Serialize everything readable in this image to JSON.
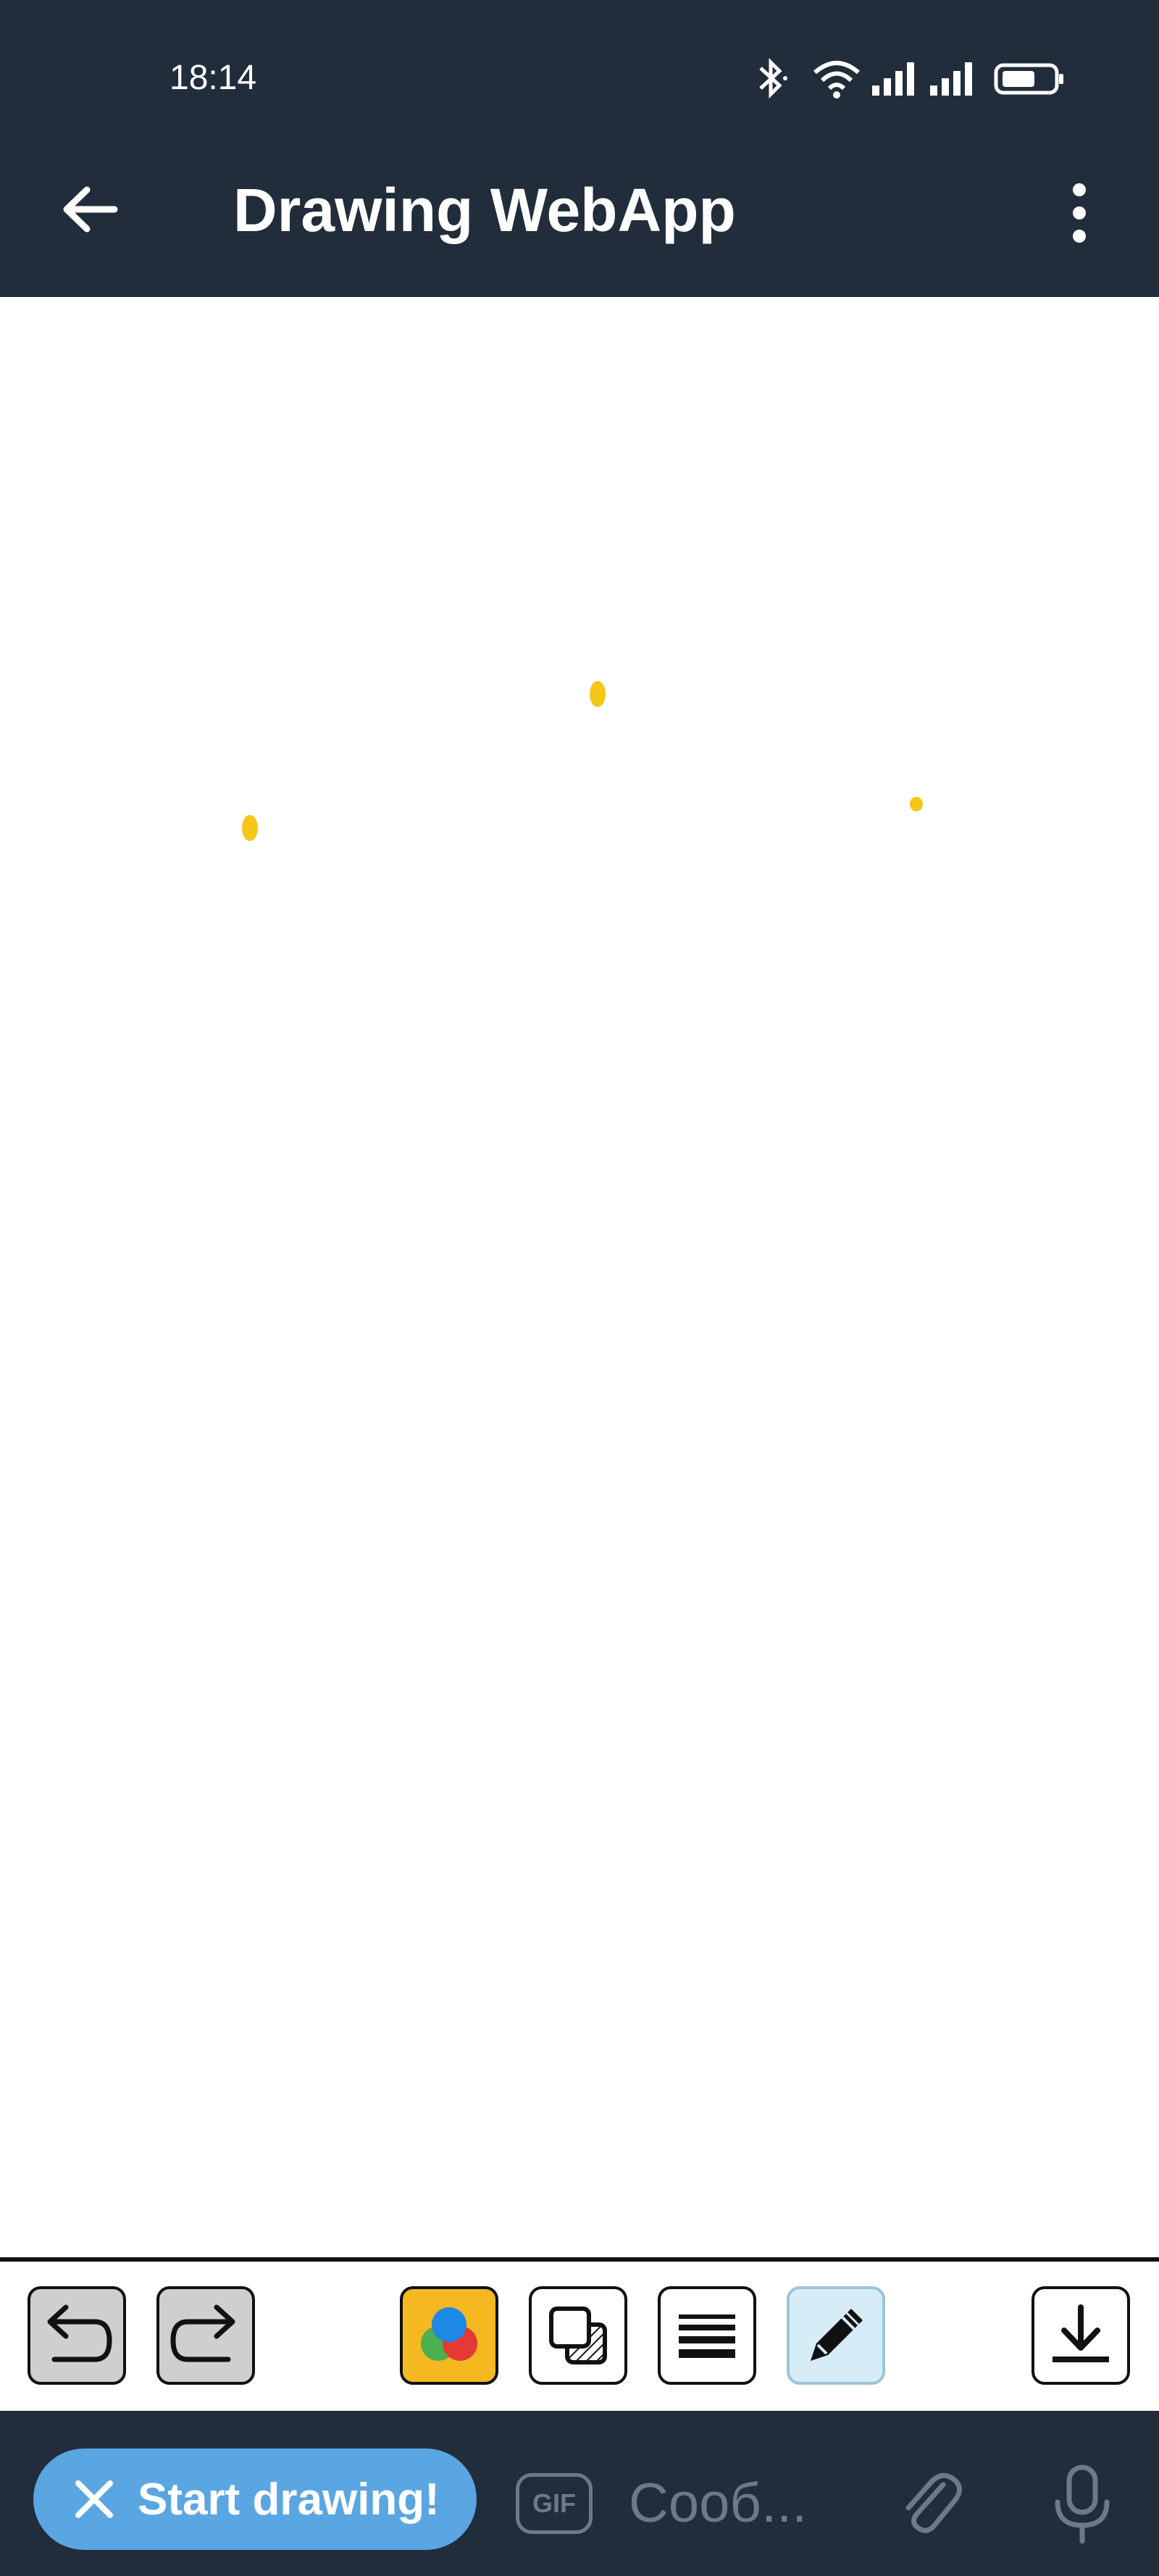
{
  "status_bar": {
    "time": "18:14",
    "icons": [
      "bluetooth-icon",
      "wifi-icon",
      "signal-icon",
      "signal-icon",
      "battery-icon"
    ]
  },
  "app_bar": {
    "title": "Drawing WebApp",
    "back_icon": "arrow-left-icon",
    "menu_icon": "more-vertical-icon"
  },
  "canvas": {
    "stroke_color": "#f5c518"
  },
  "toolbar": {
    "buttons": [
      "undo-icon",
      "redo-icon",
      "color-palette-icon",
      "layers-icon",
      "line-width-icon",
      "pencil-icon",
      "download-icon"
    ],
    "active_tool": "pencil"
  },
  "bottom_bar": {
    "start_label": "Start drawing!",
    "gif_label": "GIF",
    "message_placeholder": "Сооб...",
    "colors": {
      "background": "#212d3b",
      "accent": "#5aa6e2"
    }
  }
}
